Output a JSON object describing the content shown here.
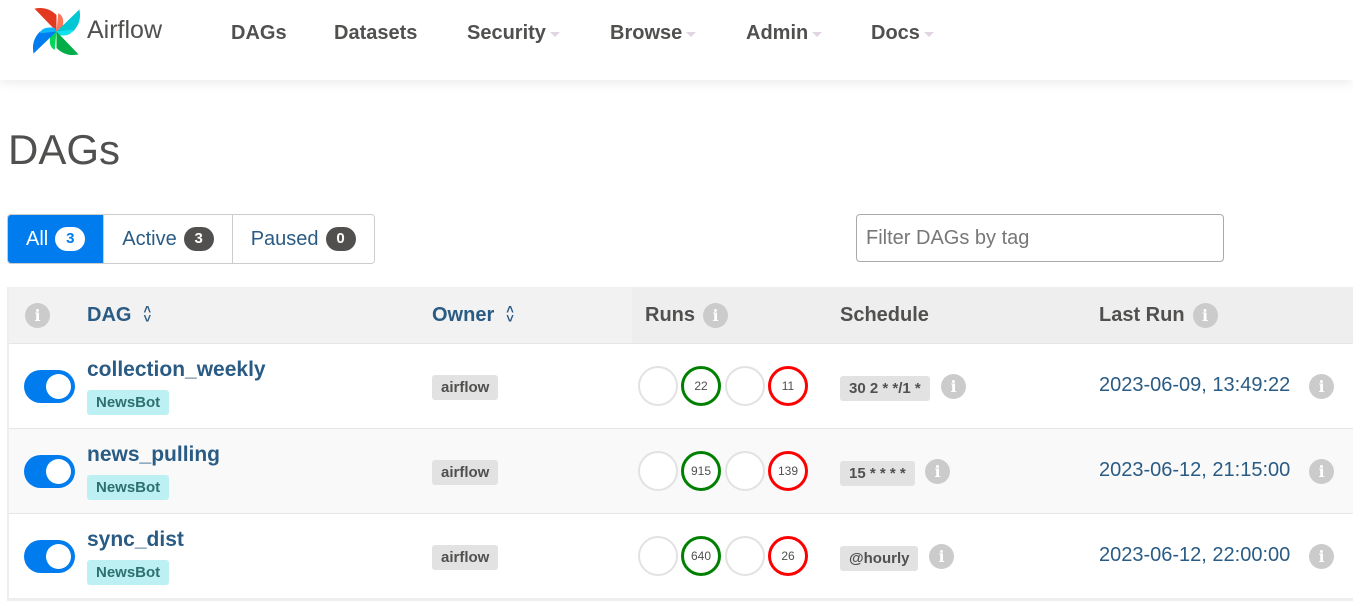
{
  "app": {
    "name": "Airflow"
  },
  "nav": {
    "items": [
      {
        "label": "DAGs",
        "dropdown": false
      },
      {
        "label": "Datasets",
        "dropdown": false
      },
      {
        "label": "Security",
        "dropdown": true
      },
      {
        "label": "Browse",
        "dropdown": true
      },
      {
        "label": "Admin",
        "dropdown": true
      },
      {
        "label": "Docs",
        "dropdown": true
      }
    ]
  },
  "page": {
    "title": "DAGs"
  },
  "status_filter": {
    "all": {
      "label": "All",
      "count": "3",
      "active": true
    },
    "active": {
      "label": "Active",
      "count": "3"
    },
    "paused": {
      "label": "Paused",
      "count": "0"
    }
  },
  "tag_filter": {
    "placeholder": "Filter DAGs by tag",
    "value": ""
  },
  "table": {
    "headers": {
      "info": "i",
      "dag": "DAG",
      "owner": "Owner",
      "runs": "Runs",
      "schedule": "Schedule",
      "last_run": "Last Run"
    },
    "rows": [
      {
        "enabled": true,
        "name": "collection_weekly",
        "tag": "NewsBot",
        "owner": "airflow",
        "runs": {
          "queued": "",
          "success": "22",
          "running": "",
          "failed": "11"
        },
        "schedule": "30 2 * */1 *",
        "last_run": "2023-06-09, 13:49:22"
      },
      {
        "enabled": true,
        "name": "news_pulling",
        "tag": "NewsBot",
        "owner": "airflow",
        "runs": {
          "queued": "",
          "success": "915",
          "running": "",
          "failed": "139"
        },
        "schedule": "15 * * * *",
        "last_run": "2023-06-12, 21:15:00"
      },
      {
        "enabled": true,
        "name": "sync_dist",
        "tag": "NewsBot",
        "owner": "airflow",
        "runs": {
          "queued": "",
          "success": "640",
          "running": "",
          "failed": "26"
        },
        "schedule": "@hourly",
        "last_run": "2023-06-12, 22:00:00"
      }
    ]
  },
  "colors": {
    "primary": "#017cee",
    "link": "#2a5b84",
    "success": "#008000",
    "failed": "#ff0000",
    "tag_bg": "#bcf0f2"
  }
}
